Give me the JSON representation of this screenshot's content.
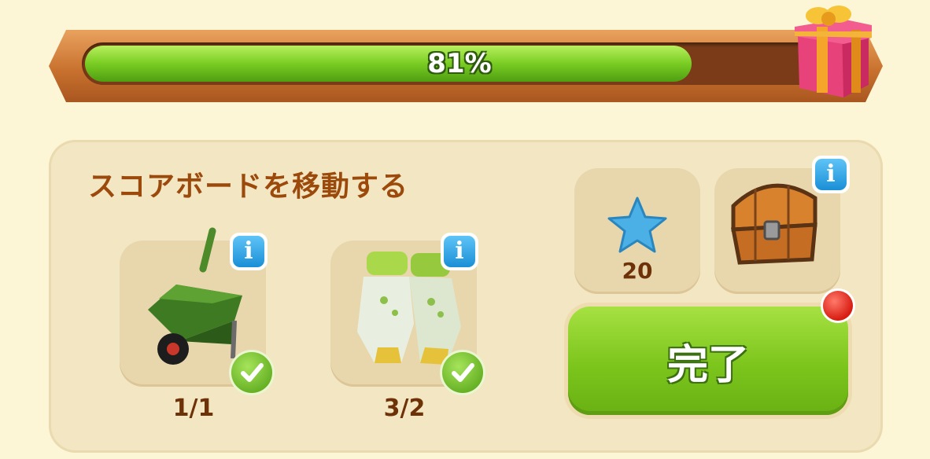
{
  "progress": {
    "percent_label": "81%",
    "fraction": 0.81
  },
  "task": {
    "title": "スコアボードを移動する",
    "required_items": [
      {
        "icon": "wheelbarrow-icon",
        "count": "1/1",
        "completed": true
      },
      {
        "icon": "gloves-icon",
        "count": "3/2",
        "completed": true
      }
    ],
    "rewards": [
      {
        "icon": "blue-star-icon",
        "amount": "20"
      },
      {
        "icon": "treasure-chest-icon"
      }
    ],
    "complete_button_label": "完了"
  },
  "icons": {
    "info": "i",
    "check": "checkmark-icon",
    "gift": "gift-box-icon"
  },
  "colors": {
    "accent_green": "#7cc51c",
    "title_brown": "#9b4a0c",
    "info_blue": "#1a8fd6",
    "alert_red": "#d81c12"
  }
}
